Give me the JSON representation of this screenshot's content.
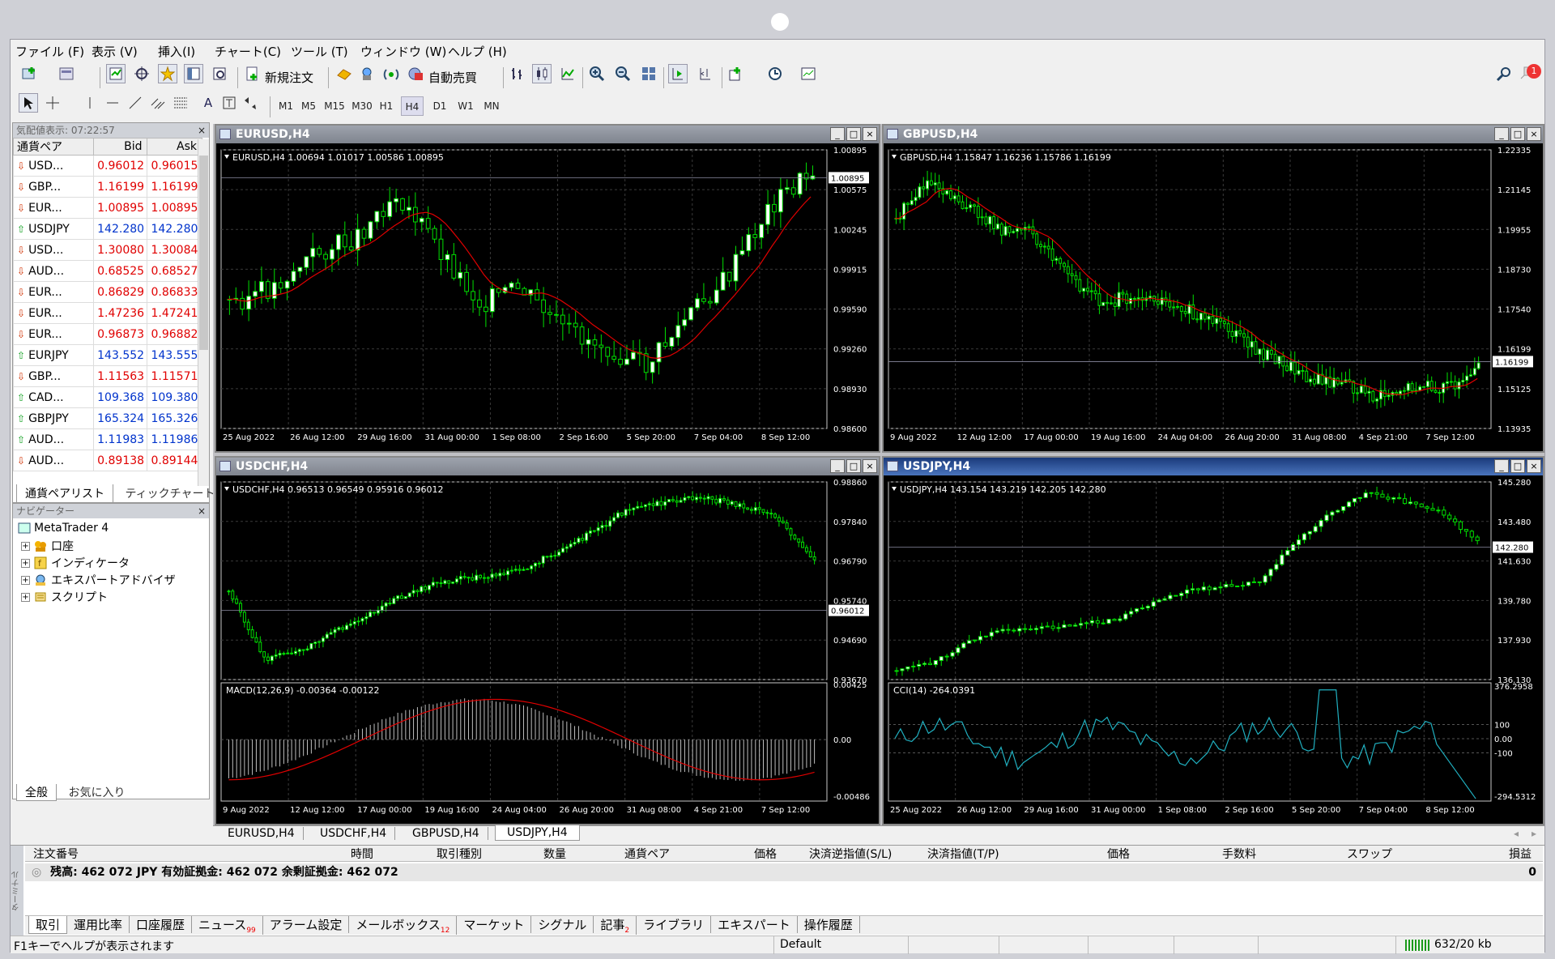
{
  "menu": [
    "ファイル (F)",
    "表示 (V)",
    "挿入(I)",
    "チャート(C)",
    "ツール (T)",
    "ウィンドウ (W)",
    "ヘルプ (H)"
  ],
  "toolbar": {
    "new_order": "新規注文",
    "auto_trade": "自動売買",
    "notification_count": "1"
  },
  "timeframes": [
    "M1",
    "M5",
    "M15",
    "M30",
    "H1",
    "H4",
    "D1",
    "W1",
    "MN"
  ],
  "timeframe_selected": "H4",
  "market_watch": {
    "title": "気配値表示: 07:22:57",
    "headers": [
      "通貨ペア",
      "Bid",
      "Ask"
    ],
    "rows": [
      {
        "sym": "USD...",
        "bid": "0.96012",
        "ask": "0.96015",
        "dir": "down"
      },
      {
        "sym": "GBP...",
        "bid": "1.16199",
        "ask": "1.16199",
        "dir": "down"
      },
      {
        "sym": "EUR...",
        "bid": "1.00895",
        "ask": "1.00895",
        "dir": "down"
      },
      {
        "sym": "USDJPY",
        "bid": "142.280",
        "ask": "142.280",
        "dir": "up"
      },
      {
        "sym": "USD...",
        "bid": "1.30080",
        "ask": "1.30084",
        "dir": "down"
      },
      {
        "sym": "AUD...",
        "bid": "0.68525",
        "ask": "0.68527",
        "dir": "down"
      },
      {
        "sym": "EUR...",
        "bid": "0.86829",
        "ask": "0.86833",
        "dir": "down"
      },
      {
        "sym": "EUR...",
        "bid": "1.47236",
        "ask": "1.47241",
        "dir": "down"
      },
      {
        "sym": "EUR...",
        "bid": "0.96873",
        "ask": "0.96882",
        "dir": "down"
      },
      {
        "sym": "EURJPY",
        "bid": "143.552",
        "ask": "143.555",
        "dir": "up"
      },
      {
        "sym": "GBP...",
        "bid": "1.11563",
        "ask": "1.11571",
        "dir": "down"
      },
      {
        "sym": "CAD...",
        "bid": "109.368",
        "ask": "109.380",
        "dir": "up"
      },
      {
        "sym": "GBPJPY",
        "bid": "165.324",
        "ask": "165.326",
        "dir": "up"
      },
      {
        "sym": "AUD...",
        "bid": "1.11983",
        "ask": "1.11986",
        "dir": "up"
      },
      {
        "sym": "AUD...",
        "bid": "0.89138",
        "ask": "0.89144",
        "dir": "down"
      }
    ],
    "tabs": [
      "通貨ペアリスト",
      "ティックチャート"
    ]
  },
  "navigator": {
    "title": "ナビゲーター",
    "root": "MetaTrader 4",
    "items": [
      "口座",
      "インディケータ",
      "エキスパートアドバイザ",
      "スクリプト"
    ],
    "tabs": [
      "全般",
      "お気に入り"
    ]
  },
  "charts": [
    {
      "title": "EURUSD,H4",
      "info": "EURUSD,H4  1.00694 1.01017 1.00586 1.00895",
      "price_label": "1.00895",
      "yticks": [
        "1.00895",
        "1.00575",
        "1.00245",
        "0.99915",
        "0.99590",
        "0.99260",
        "0.98930",
        "0.98600"
      ],
      "xticks": [
        "25 Aug 2022",
        "26 Aug 12:00",
        "29 Aug 16:00",
        "31 Aug 00:00",
        "1 Sep 08:00",
        "2 Sep 16:00",
        "5 Sep 20:00",
        "7 Sep 04:00",
        "8 Sep 12:00"
      ]
    },
    {
      "title": "GBPUSD,H4",
      "info": "GBPUSD,H4  1.15847 1.16236 1.15786 1.16199",
      "price_label": "1.16199",
      "yticks": [
        "1.22335",
        "1.21145",
        "1.19955",
        "1.18730",
        "1.17540",
        "1.16199",
        "1.15125",
        "1.13935"
      ],
      "xticks": [
        "9 Aug 2022",
        "12 Aug 12:00",
        "17 Aug 00:00",
        "19 Aug 16:00",
        "24 Aug 04:00",
        "26 Aug 20:00",
        "31 Aug 08:00",
        "4 Sep 21:00",
        "7 Sep 12:00"
      ]
    },
    {
      "title": "USDCHF,H4",
      "info": "USDCHF,H4  0.96513 0.96549 0.95916 0.96012",
      "price_label": "0.96012",
      "yticks": [
        "0.98860",
        "0.97840",
        "0.96790",
        "0.95740",
        "0.94690",
        "0.93670"
      ],
      "sub_info": "MACD(12,26,9) -0.00364 -0.00122",
      "sub_yticks": [
        "0.00425",
        "0.00",
        "-0.00486"
      ],
      "xticks": [
        "9 Aug 2022",
        "12 Aug 12:00",
        "17 Aug 00:00",
        "19 Aug 16:00",
        "24 Aug 04:00",
        "26 Aug 20:00",
        "31 Aug 08:00",
        "4 Sep 21:00",
        "7 Sep 12:00"
      ]
    },
    {
      "title": "USDJPY,H4",
      "info": "USDJPY,H4  143.154 143.219 142.205 142.280",
      "price_label": "142.280",
      "yticks": [
        "145.280",
        "143.480",
        "141.630",
        "139.780",
        "137.930",
        "136.130"
      ],
      "sub_info": "CCI(14) -264.0391",
      "sub_yticks": [
        "376.2958",
        "100",
        "0.00",
        "-100",
        "-294.5312"
      ],
      "xticks": [
        "25 Aug 2022",
        "26 Aug 12:00",
        "29 Aug 16:00",
        "31 Aug 00:00",
        "1 Sep 08:00",
        "2 Sep 16:00",
        "5 Sep 20:00",
        "7 Sep 04:00",
        "8 Sep 12:00"
      ]
    }
  ],
  "chart_tabs": [
    "EURUSD,H4",
    "USDCHF,H4",
    "GBPUSD,H4",
    "USDJPY,H4"
  ],
  "terminal": {
    "headers": [
      "注文番号",
      "時間",
      "取引種別",
      "数量",
      "通貨ペア",
      "価格",
      "決済逆指値(S/L)",
      "決済指値(T/P)",
      "価格",
      "手数料",
      "スワップ",
      "損益"
    ],
    "balance": "残高: 462 072 JPY  有効証拠金: 462 072  余剰証拠金: 462 072",
    "profit": "0",
    "side_label": "ターミナル",
    "tabs": [
      "取引",
      "運用比率",
      "口座履歴",
      "ニュース",
      "アラーム設定",
      "メールボックス",
      "マーケット",
      "シグナル",
      "記事",
      "ライブラリ",
      "エキスパート",
      "操作履歴"
    ],
    "badges": {
      "news": "99",
      "mail": "12",
      "articles": "2"
    }
  },
  "status": {
    "help": "F1キーでヘルプが表示されます",
    "profile": "Default",
    "traffic": "632/20 kb"
  }
}
